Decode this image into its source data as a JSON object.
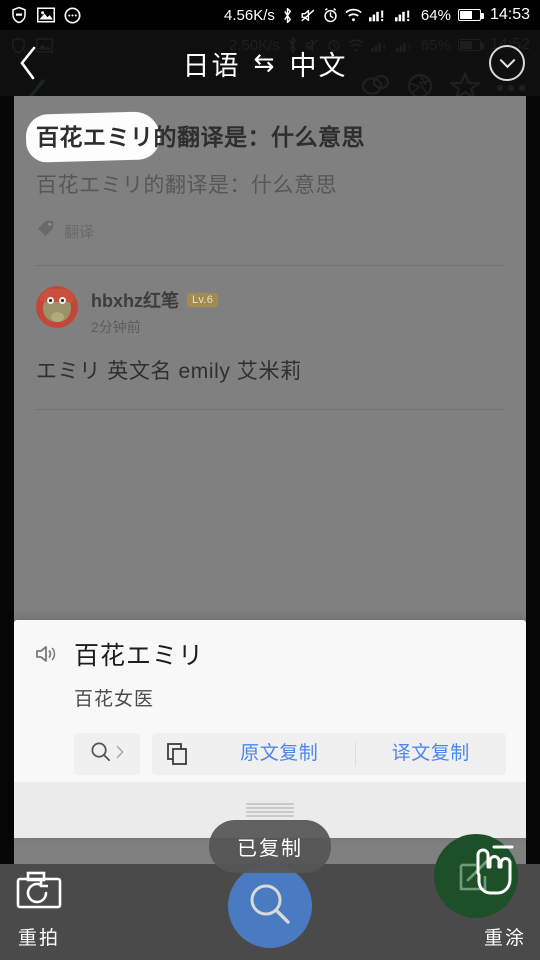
{
  "status_bar": {
    "left_icons": [
      "shield-icon",
      "gallery-icon",
      "dots-circle-icon"
    ],
    "network_speed": "4.56K/s",
    "right_icons": [
      "bluetooth-icon",
      "mute-icon",
      "alarm-icon",
      "wifi-icon",
      "signal-1-icon",
      "signal-2-icon"
    ],
    "battery_percent": "64%",
    "time": "14:53"
  },
  "ghost_status_bar": {
    "network_speed": "2.50K/s",
    "battery_percent": "65%",
    "time": "14:52"
  },
  "translate_header": {
    "back_icon": "chevron-left-icon",
    "source_language": "日语",
    "swap_symbol": "⇆",
    "target_language": "中文",
    "collapse_icon": "chevron-down-circle-icon"
  },
  "ghost_toolbar_icons": [
    "chat-bubbles-icon",
    "camera-aperture-icon",
    "star-icon",
    "more-dots-icon"
  ],
  "question": {
    "title": "百花エミリ的翻译是：什么意思",
    "subtitle": "百花エミリ的翻译是：什么意思",
    "tag_icon": "tag-icon",
    "tag_label": "翻译"
  },
  "answer": {
    "avatar": "user-avatar",
    "username": "hbxhz红笔",
    "level_badge": "Lv.6",
    "timestamp": "2分钟前",
    "text": "エミリ 英文名 emily 艾米莉"
  },
  "translate_sheet": {
    "speaker_icon": "speaker-icon",
    "source_text": "百花エミリ",
    "translated_text": "百花女医",
    "search_icon": "search-icon",
    "search_chevron_icon": "chevron-right-icon",
    "copy_icon": "copy-icon",
    "copy_source_label": "原文复制",
    "copy_translation_label": "译文复制",
    "grabber": "drag-handle"
  },
  "toast": {
    "message": "已复制"
  },
  "toolbar": {
    "retake_icon": "camera-retake-icon",
    "retake_label": "重拍",
    "search_fab_icon": "search-icon",
    "repaint_icon": "edit-square-icon",
    "repaint_label": "重涂",
    "cursor": "hand-pointer-cursor"
  },
  "colors": {
    "accent_blue": "#4a87f0",
    "fab_blue": "#4a7ac0",
    "fab_green": "#1d5028",
    "badge_gold": "#a08c4e",
    "dim_overlay": "#808080"
  }
}
